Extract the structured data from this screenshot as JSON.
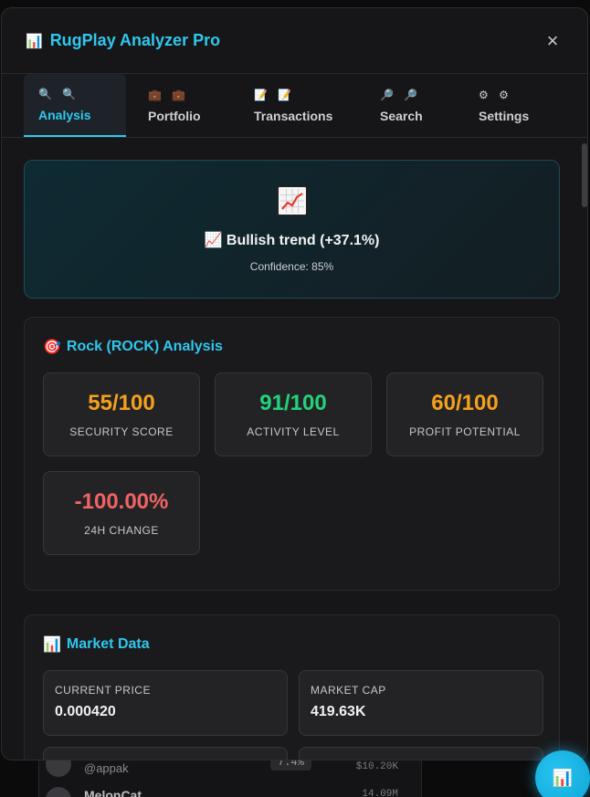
{
  "background": {
    "handle": "@appak",
    "chip": "7.4%",
    "value1": "$10.20K",
    "name": "MelonCat",
    "value2": "14.09M"
  },
  "header": {
    "icon": "📊",
    "title": "RugPlay Analyzer Pro",
    "close": "×"
  },
  "tabs": [
    {
      "icon": "🔍 🔍",
      "label": "Analysis"
    },
    {
      "icon": "💼 💼",
      "label": "Portfolio"
    },
    {
      "icon": "📝 📝",
      "label": "Transactions"
    },
    {
      "icon": "🔎 🔎",
      "label": "Search"
    },
    {
      "icon": "⚙ ⚙",
      "label": "Settings"
    }
  ],
  "trend": {
    "icon": "📈",
    "label": "📈 Bullish trend (+37.1%)",
    "confidence": "Confidence: 85%"
  },
  "analysis": {
    "title_icon": "🎯",
    "title": "Rock (ROCK) Analysis",
    "metrics": [
      {
        "value": "55/100",
        "label": "SECURITY SCORE",
        "color": "#f5a11c"
      },
      {
        "value": "91/100",
        "label": "ACTIVITY LEVEL",
        "color": "#22d37a"
      },
      {
        "value": "60/100",
        "label": "PROFIT POTENTIAL",
        "color": "#f5a11c"
      },
      {
        "value": "-100.00%",
        "label": "24H CHANGE",
        "color": "#f26363"
      }
    ]
  },
  "market": {
    "title_icon": "📊",
    "title": "Market Data",
    "cells": [
      {
        "label": "CURRENT PRICE",
        "value": "0.000420"
      },
      {
        "label": "MARKET CAP",
        "value": "419.63K"
      }
    ]
  },
  "fab": {
    "icon": "📊"
  },
  "colors": {
    "accent": "#2fc7ee",
    "orange": "#f5a11c",
    "green": "#22d37a",
    "red": "#f26363"
  }
}
